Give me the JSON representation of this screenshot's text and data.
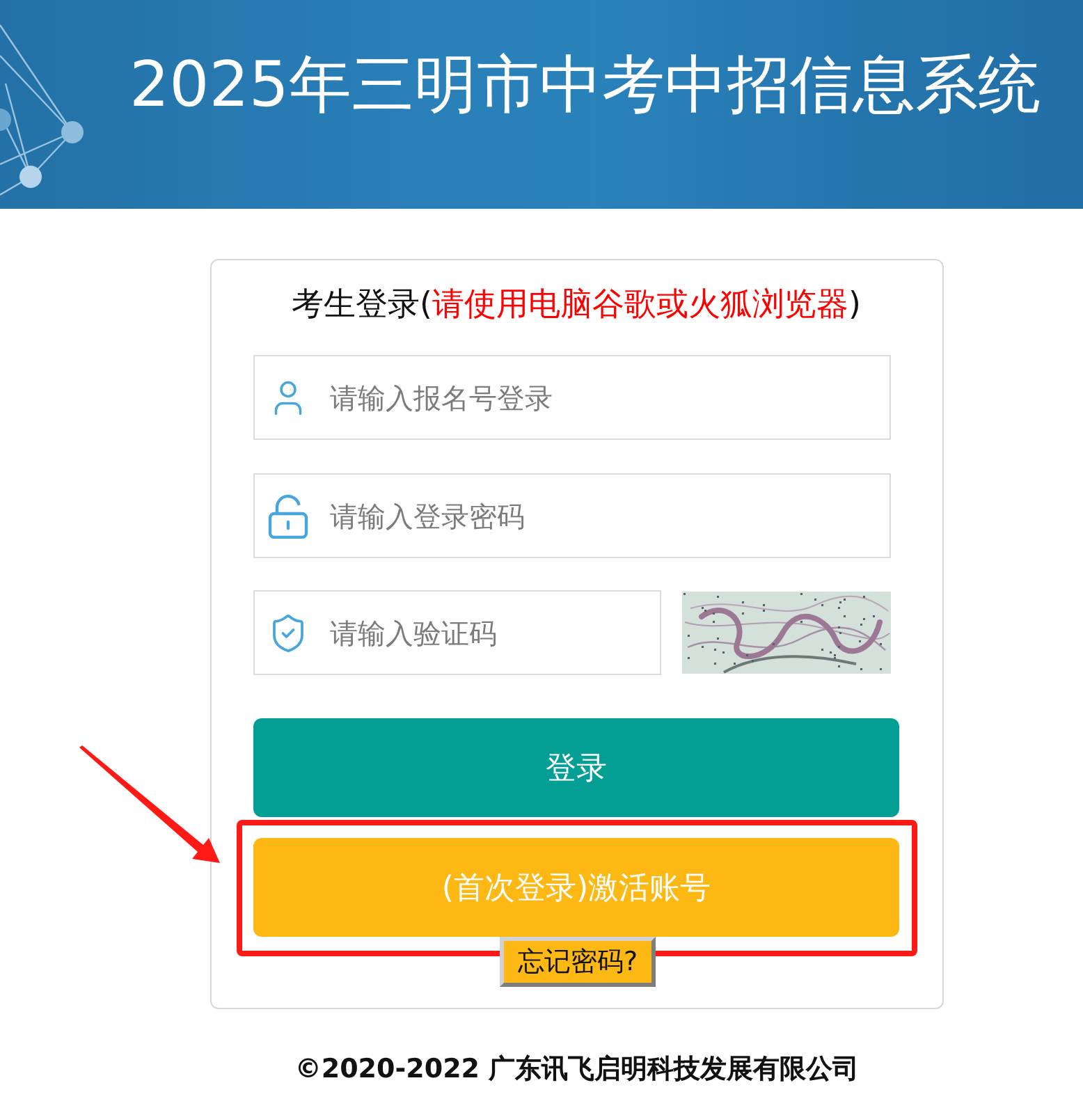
{
  "header": {
    "title": "2025年三明市中考中招信息系统"
  },
  "login": {
    "heading": [
      {
        "kind": "plain",
        "text": "考生登录("
      },
      {
        "kind": "warning",
        "text": "请使用电脑谷歌或火狐浏览器"
      },
      {
        "kind": "plain",
        "text": ")"
      }
    ],
    "fields": [
      {
        "kind": "username",
        "placeholder": "请输入报名号登录"
      },
      {
        "kind": "password",
        "placeholder": "请输入登录密码"
      },
      {
        "kind": "captcha",
        "placeholder": "请输入验证码"
      }
    ],
    "buttons": [
      {
        "kind": "primary",
        "label": "登录"
      },
      {
        "kind": "activate",
        "label": "(首次登录)激活账号"
      }
    ],
    "forgot_password": "忘记密码?"
  },
  "footer": {
    "copyright": "©2020-2022 广东讯飞启明科技发展有限公司"
  }
}
